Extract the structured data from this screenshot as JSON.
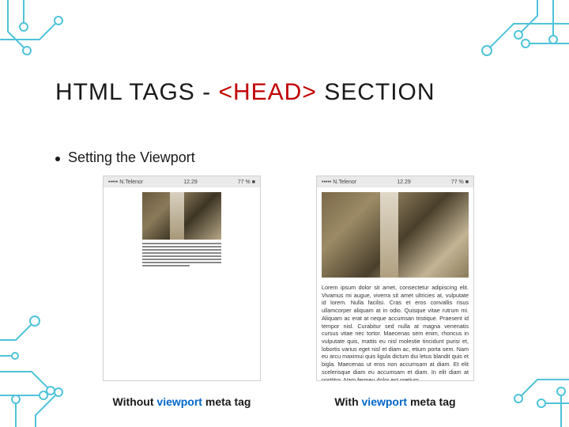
{
  "title": {
    "part1": "HTML TAGS - ",
    "part2": "<HEAD>",
    "part3": " SECTION"
  },
  "bullet": "Setting the Viewport",
  "phoneA": {
    "carrier": "••••• N.Telenor",
    "signal": "⌃",
    "time": "12.29",
    "battery": "77 %",
    "batteryIcon": "■"
  },
  "phoneB": {
    "carrier": "••••• N.Telenor",
    "signal": "⌃",
    "time": "12.29",
    "battery": "77 %",
    "batteryIcon": "■",
    "lorem": "Lorem ipsum dolor sit amet, consectetur adipiscing elit. Vivamus mi augue, viverra sit amet ultricies at, vulputate id lorem. Nulla facilisi. Cras et eros convallis risus ullamcorper aliquam at in odio. Quisque vitae rutrum mi. Aliquam ac erat at neque accumsan tristique. Praesent id tempor nisl. Curabitur sed nulla at magna venenatis cursus vitae nec tortor. Maecenas sem enim, rhoncus in vulputate quis, mattis eu nisl molestie tincidunt purisi et, lobortis varius eget nisl et diam ac, etium porta sem. Nam eu arcu maximui quis ligula dictum dui letus blandit quis et bigla. Maecenas ut eros non accumsam at diam. Et elit scelerisque diam eu accumsam et diam. In elit diam at porttitor. Nam fermeu dolor est pretium."
  },
  "captions": {
    "left_pre": "Without ",
    "left_key": "viewport",
    "left_post": " meta tag",
    "right_pre": "With ",
    "right_key": "viewport",
    "right_post": " meta tag"
  }
}
